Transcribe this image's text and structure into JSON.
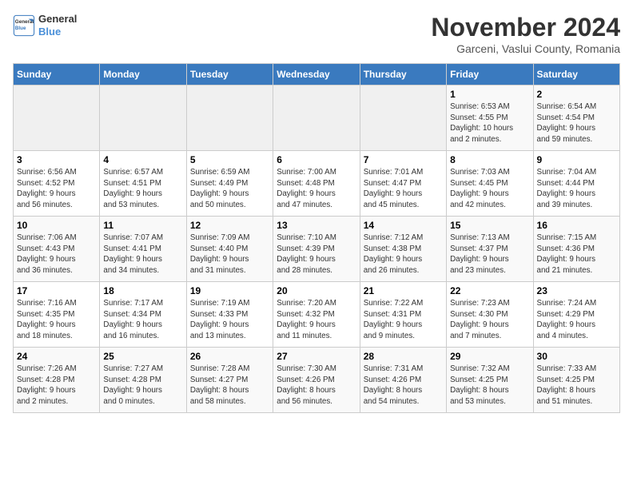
{
  "logo": {
    "line1": "General",
    "line2": "Blue"
  },
  "title": "November 2024",
  "subtitle": "Garceni, Vaslui County, Romania",
  "days_of_week": [
    "Sunday",
    "Monday",
    "Tuesday",
    "Wednesday",
    "Thursday",
    "Friday",
    "Saturday"
  ],
  "weeks": [
    [
      {
        "day": "",
        "info": ""
      },
      {
        "day": "",
        "info": ""
      },
      {
        "day": "",
        "info": ""
      },
      {
        "day": "",
        "info": ""
      },
      {
        "day": "",
        "info": ""
      },
      {
        "day": "1",
        "info": "Sunrise: 6:53 AM\nSunset: 4:55 PM\nDaylight: 10 hours\nand 2 minutes."
      },
      {
        "day": "2",
        "info": "Sunrise: 6:54 AM\nSunset: 4:54 PM\nDaylight: 9 hours\nand 59 minutes."
      }
    ],
    [
      {
        "day": "3",
        "info": "Sunrise: 6:56 AM\nSunset: 4:52 PM\nDaylight: 9 hours\nand 56 minutes."
      },
      {
        "day": "4",
        "info": "Sunrise: 6:57 AM\nSunset: 4:51 PM\nDaylight: 9 hours\nand 53 minutes."
      },
      {
        "day": "5",
        "info": "Sunrise: 6:59 AM\nSunset: 4:49 PM\nDaylight: 9 hours\nand 50 minutes."
      },
      {
        "day": "6",
        "info": "Sunrise: 7:00 AM\nSunset: 4:48 PM\nDaylight: 9 hours\nand 47 minutes."
      },
      {
        "day": "7",
        "info": "Sunrise: 7:01 AM\nSunset: 4:47 PM\nDaylight: 9 hours\nand 45 minutes."
      },
      {
        "day": "8",
        "info": "Sunrise: 7:03 AM\nSunset: 4:45 PM\nDaylight: 9 hours\nand 42 minutes."
      },
      {
        "day": "9",
        "info": "Sunrise: 7:04 AM\nSunset: 4:44 PM\nDaylight: 9 hours\nand 39 minutes."
      }
    ],
    [
      {
        "day": "10",
        "info": "Sunrise: 7:06 AM\nSunset: 4:43 PM\nDaylight: 9 hours\nand 36 minutes."
      },
      {
        "day": "11",
        "info": "Sunrise: 7:07 AM\nSunset: 4:41 PM\nDaylight: 9 hours\nand 34 minutes."
      },
      {
        "day": "12",
        "info": "Sunrise: 7:09 AM\nSunset: 4:40 PM\nDaylight: 9 hours\nand 31 minutes."
      },
      {
        "day": "13",
        "info": "Sunrise: 7:10 AM\nSunset: 4:39 PM\nDaylight: 9 hours\nand 28 minutes."
      },
      {
        "day": "14",
        "info": "Sunrise: 7:12 AM\nSunset: 4:38 PM\nDaylight: 9 hours\nand 26 minutes."
      },
      {
        "day": "15",
        "info": "Sunrise: 7:13 AM\nSunset: 4:37 PM\nDaylight: 9 hours\nand 23 minutes."
      },
      {
        "day": "16",
        "info": "Sunrise: 7:15 AM\nSunset: 4:36 PM\nDaylight: 9 hours\nand 21 minutes."
      }
    ],
    [
      {
        "day": "17",
        "info": "Sunrise: 7:16 AM\nSunset: 4:35 PM\nDaylight: 9 hours\nand 18 minutes."
      },
      {
        "day": "18",
        "info": "Sunrise: 7:17 AM\nSunset: 4:34 PM\nDaylight: 9 hours\nand 16 minutes."
      },
      {
        "day": "19",
        "info": "Sunrise: 7:19 AM\nSunset: 4:33 PM\nDaylight: 9 hours\nand 13 minutes."
      },
      {
        "day": "20",
        "info": "Sunrise: 7:20 AM\nSunset: 4:32 PM\nDaylight: 9 hours\nand 11 minutes."
      },
      {
        "day": "21",
        "info": "Sunrise: 7:22 AM\nSunset: 4:31 PM\nDaylight: 9 hours\nand 9 minutes."
      },
      {
        "day": "22",
        "info": "Sunrise: 7:23 AM\nSunset: 4:30 PM\nDaylight: 9 hours\nand 7 minutes."
      },
      {
        "day": "23",
        "info": "Sunrise: 7:24 AM\nSunset: 4:29 PM\nDaylight: 9 hours\nand 4 minutes."
      }
    ],
    [
      {
        "day": "24",
        "info": "Sunrise: 7:26 AM\nSunset: 4:28 PM\nDaylight: 9 hours\nand 2 minutes."
      },
      {
        "day": "25",
        "info": "Sunrise: 7:27 AM\nSunset: 4:28 PM\nDaylight: 9 hours\nand 0 minutes."
      },
      {
        "day": "26",
        "info": "Sunrise: 7:28 AM\nSunset: 4:27 PM\nDaylight: 8 hours\nand 58 minutes."
      },
      {
        "day": "27",
        "info": "Sunrise: 7:30 AM\nSunset: 4:26 PM\nDaylight: 8 hours\nand 56 minutes."
      },
      {
        "day": "28",
        "info": "Sunrise: 7:31 AM\nSunset: 4:26 PM\nDaylight: 8 hours\nand 54 minutes."
      },
      {
        "day": "29",
        "info": "Sunrise: 7:32 AM\nSunset: 4:25 PM\nDaylight: 8 hours\nand 53 minutes."
      },
      {
        "day": "30",
        "info": "Sunrise: 7:33 AM\nSunset: 4:25 PM\nDaylight: 8 hours\nand 51 minutes."
      }
    ]
  ]
}
